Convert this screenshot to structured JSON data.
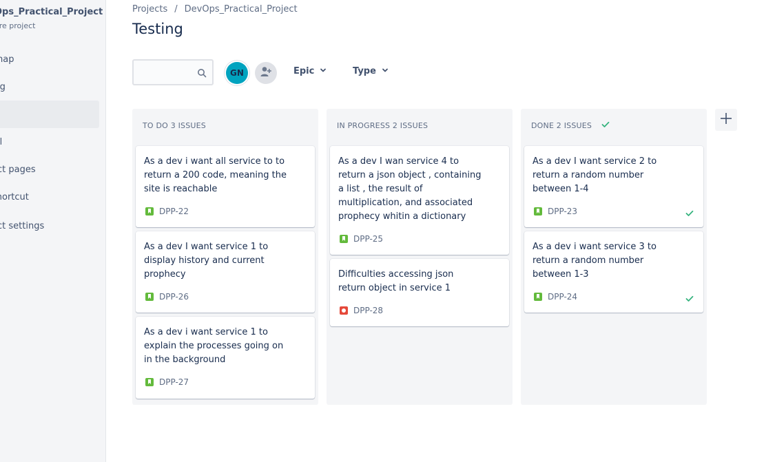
{
  "sidebar": {
    "project_name": "DevOps_Practical_Project",
    "project_name_visible": "Ops_Practical_Project",
    "project_type": "are project",
    "items": [
      {
        "label": "lmap"
      },
      {
        "label": "log"
      },
      {
        "label": "d",
        "active": true
      },
      {
        "label": "all"
      },
      {
        "label": "ect pages"
      },
      {
        "label": "shortcut"
      },
      {
        "label": "ect settings"
      }
    ]
  },
  "breadcrumb": {
    "projects": "Projects",
    "separator": "/",
    "project": "DevOps_Practical_Project"
  },
  "page_title": "Testing",
  "toolbar": {
    "search_placeholder": "",
    "avatar_initials": "GN",
    "filters": [
      {
        "label": "Epic"
      },
      {
        "label": "Type"
      }
    ]
  },
  "columns": [
    {
      "header": "TO DO 3 ISSUES",
      "cards": [
        {
          "text": "As a dev i want all service to to return a 200 code, meaning the site is reachable",
          "key": "DPP-22",
          "type": "story"
        },
        {
          "text": "As a dev I want service 1 to display history and current prophecy",
          "key": "DPP-26",
          "type": "story"
        },
        {
          "text": "As a dev i want service 1 to explain the processes going on in the background",
          "key": "DPP-27",
          "type": "story"
        }
      ]
    },
    {
      "header": "IN PROGRESS 2 ISSUES",
      "cards": [
        {
          "text": "As a dev I wan service 4 to return a json object , containing a list , the result of multiplication, and associated prophecy whitin a dictionary",
          "key": "DPP-25",
          "type": "story"
        },
        {
          "text": "Difficulties accessing json return object in service 1",
          "key": "DPP-28",
          "type": "bug"
        }
      ]
    },
    {
      "header": "DONE 2 ISSUES",
      "cards": [
        {
          "text": "As a dev I want service 2 to return a random number between 1-4",
          "key": "DPP-23",
          "type": "story",
          "done": true
        },
        {
          "text": "As a dev i want service 3 to return a random number between 1-3",
          "key": "DPP-24",
          "type": "story",
          "done": true
        }
      ]
    }
  ],
  "colors": {
    "accent": "#0052cc",
    "done_check": "#36b37e",
    "story": "#63ba3c",
    "bug": "#e5493a",
    "avatar_bg": "#00a3bf"
  }
}
